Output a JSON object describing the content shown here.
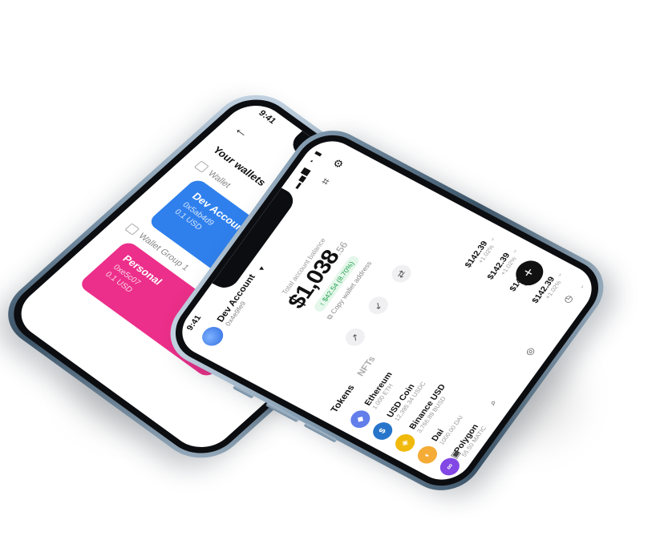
{
  "back_phone": {
    "time": "9:41",
    "title": "Wallets",
    "section": "Your wallets",
    "groups": [
      "Wallet",
      "Wallet Group 1"
    ],
    "cards": [
      {
        "name": "Dev Account",
        "addr": "0x5ab4d9",
        "bal": "0.1 USD",
        "color": "#2f80ed"
      },
      {
        "name": "Personal",
        "addr": "0xe5c07",
        "bal": "0.1 USD",
        "color": "#ec2f8a"
      }
    ]
  },
  "front_phone": {
    "time": "9:41",
    "account_name": "Dev Account",
    "account_addr": "0x4e9fe9",
    "balance_label": "Total account balance",
    "balance_main": "$1,038",
    "balance_cents": ".56",
    "balance_change": "↑ $42.54 (8.70%)",
    "copy_text": "Copy wallet address",
    "tabs": [
      "Tokens",
      "NFTs"
    ],
    "tokens": [
      {
        "name": "Ethereum",
        "sub": "1.000 ETH",
        "usd": "$142.39",
        "pct": "+1.02%",
        "color": "#627eea",
        "glyph": "◆"
      },
      {
        "name": "USD Coin",
        "sub": "12,395.34 USDC",
        "usd": "$142.39",
        "pct": "+1.02%",
        "color": "#2775ca",
        "glyph": "$"
      },
      {
        "name": "Binance USD",
        "sub": "3,766.89 BUSD",
        "usd": "$142.39",
        "pct": "+1.02%",
        "color": "#f0b90b",
        "glyph": "◈"
      },
      {
        "name": "Dai",
        "sub": "1000.00 DAI",
        "usd": "$142.39",
        "pct": "+1.02%",
        "color": "#f5ac37",
        "glyph": "◐"
      },
      {
        "name": "Polygon",
        "sub": "55.50 MATIC",
        "usd": "",
        "pct": "",
        "color": "#8247e5",
        "glyph": "∞"
      }
    ],
    "fab": "+"
  }
}
